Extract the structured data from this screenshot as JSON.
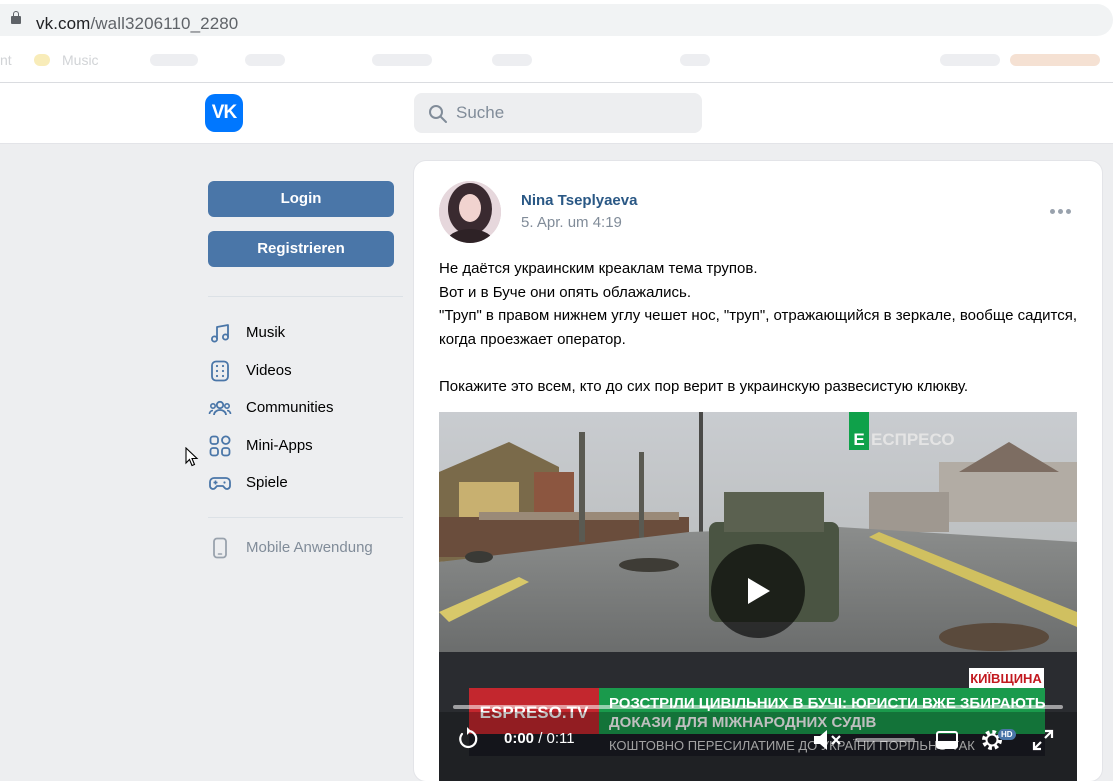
{
  "browser": {
    "url_domain": "vk.com",
    "url_path": "/wall3206110_2280",
    "bookmarks": [
      "nt",
      "Music"
    ]
  },
  "header": {
    "logo_text": "VK",
    "search_placeholder": "Suche"
  },
  "sidebar": {
    "login_label": "Login",
    "register_label": "Registrieren",
    "items": [
      {
        "label": "Musik",
        "icon": "music-icon"
      },
      {
        "label": "Videos",
        "icon": "video-icon"
      },
      {
        "label": "Communities",
        "icon": "communities-icon"
      },
      {
        "label": "Mini-Apps",
        "icon": "mini-apps-icon"
      },
      {
        "label": "Spiele",
        "icon": "gamepad-icon"
      }
    ],
    "mobile_label": "Mobile Anwendung"
  },
  "post": {
    "author": "Nina Tseplyaeva",
    "date": "5. Apr. um 4:19",
    "text": [
      "Не даётся украинским креаклам тема трупов.",
      "Вот и в Буче они опять облажались.",
      "\"Труп\" в правом нижнем углу чешет нос, \"труп\", отражающийся в зеркале, вообще садится, когда проезжает оператор.",
      "",
      "Покажите это всем, кто до сих пор верит в украинскую развесистую клюкву."
    ]
  },
  "video": {
    "channel_logo": "ЕСПРЕСО",
    "region_tag": "КИЇВЩИНА",
    "brand": "ESPRESO.TV",
    "headline_line1": "РОЗСТРІЛИ ЦИВІЛЬНИХ В БУЧІ: ЮРИСТИ ВЖЕ ЗБИРАЮТЬ",
    "headline_line2": "ДОКАЗИ ДЛЯ МІЖНАРОДНИХ СУДІВ",
    "ticker": "КОШТОВНО ПЕРЕСИЛАТИМЕ ДО УКРАЇНИ ПОРІЛЬНО ТАК",
    "time_current": "0:00",
    "time_total": " / 0:11",
    "quality_badge": "HD",
    "progress": 0
  }
}
